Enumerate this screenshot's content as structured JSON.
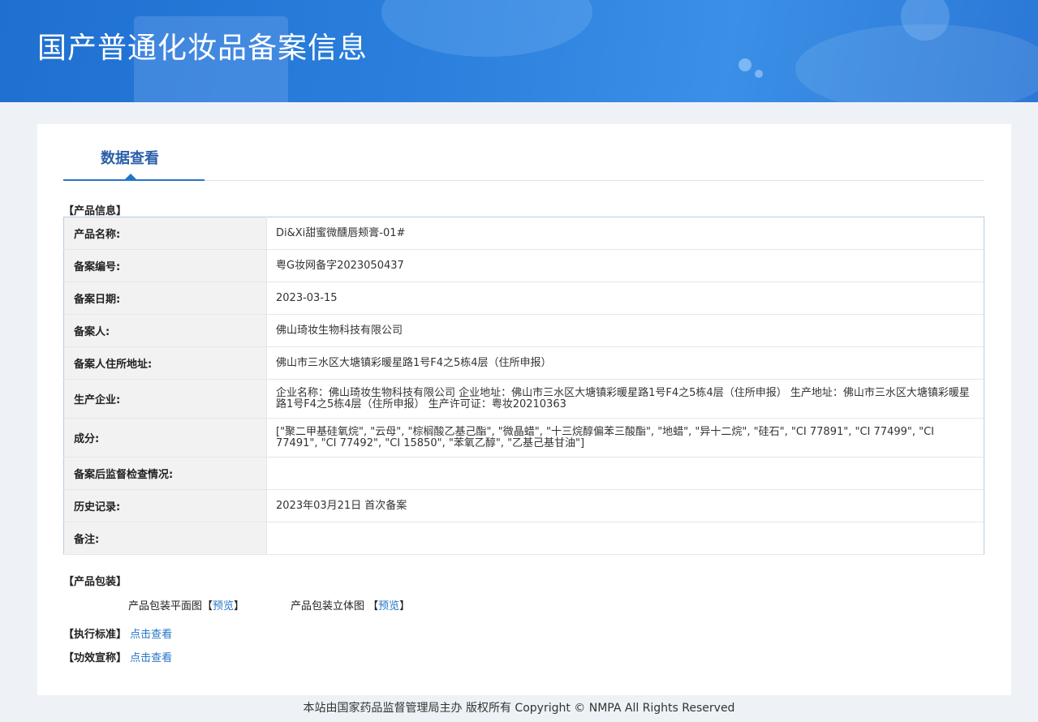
{
  "header": {
    "title": "国产普通化妆品备案信息"
  },
  "tab": {
    "label": "数据查看"
  },
  "product_info": {
    "section_label": "【产品信息】",
    "rows": [
      {
        "label": "产品名称:",
        "value": "Di&Xi甜蜜微醺唇颊膏-01#"
      },
      {
        "label": "备案编号:",
        "value": "粤G妆网备字2023050437"
      },
      {
        "label": "备案日期:",
        "value": "2023-03-15"
      },
      {
        "label": "备案人:",
        "value": "佛山琦妆生物科技有限公司"
      },
      {
        "label": "备案人住所地址:",
        "value": "佛山市三水区大塘镇彩暖星路1号F4之5栋4层（住所申报）"
      },
      {
        "label": "生产企业:",
        "value": "企业名称：佛山琦妆生物科技有限公司 企业地址：佛山市三水区大塘镇彩暖星路1号F4之5栋4层（住所申报） 生产地址：佛山市三水区大塘镇彩暖星路1号F4之5栋4层（住所申报） 生产许可证：粤妆20210363"
      },
      {
        "label": "成分:",
        "value": "[\"聚二甲基硅氧烷\", \"云母\", \"棕榈酸乙基己酯\", \"微晶蜡\", \"十三烷醇偏苯三酸酯\", \"地蜡\", \"异十二烷\", \"硅石\", \"CI 77891\", \"CI 77499\", \"CI 77491\", \"CI 77492\", \"CI 15850\", \"苯氧乙醇\", \"乙基己基甘油\"]"
      },
      {
        "label": "备案后监督检查情况:",
        "value": ""
      },
      {
        "label": "历史记录:",
        "value": "2023年03月21日 首次备案"
      },
      {
        "label": "备注:",
        "value": ""
      }
    ]
  },
  "packaging": {
    "section_label": "【产品包装】",
    "flat_label": "产品包装平面图",
    "flat_open": "【",
    "flat_link": "预览",
    "flat_close": "】",
    "stereo_label": "产品包装立体图 ",
    "stereo_open": "【",
    "stereo_link": "预览",
    "stereo_close": "】"
  },
  "standard": {
    "label": "【执行标准】",
    "link": "点击查看"
  },
  "efficacy": {
    "label": "【功效宣称】",
    "link": "点击查看"
  },
  "footer": {
    "text": "本站由国家药品监督管理局主办 版权所有 Copyright © NMPA All Rights Reserved"
  }
}
